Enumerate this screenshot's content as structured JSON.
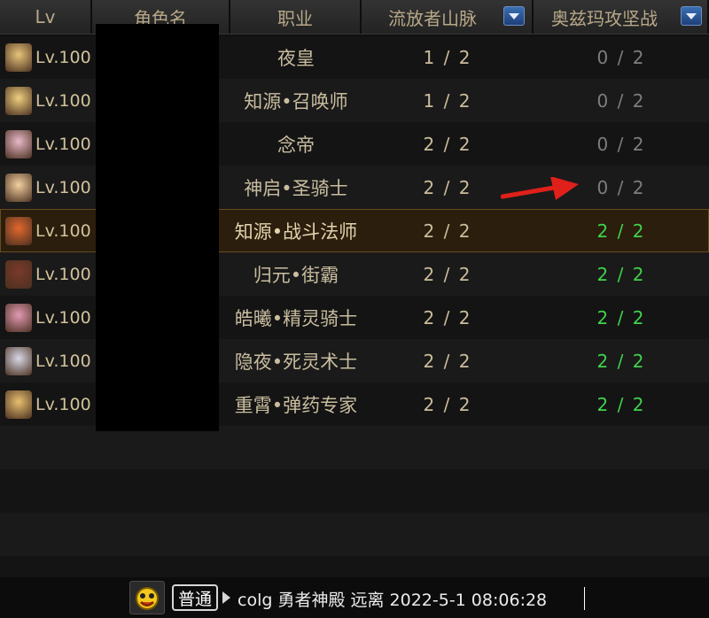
{
  "header": {
    "columns": [
      "Lv",
      "角色名",
      "职业",
      "流放者山脉",
      "奥兹玛攻坚战"
    ]
  },
  "rows": [
    {
      "level": "Lv.100",
      "job": "夜皇",
      "mountain": "1 / 2",
      "ozma": "0 / 2",
      "ozma_done": false,
      "avatar_color": "#e8c47a"
    },
    {
      "level": "Lv.100",
      "job": "知源•召唤师",
      "mountain": "1 / 2",
      "ozma": "0 / 2",
      "ozma_done": false,
      "avatar_color": "#f0d080"
    },
    {
      "level": "Lv.100",
      "job": "念帝",
      "mountain": "2 / 2",
      "ozma": "0 / 2",
      "ozma_done": false,
      "avatar_color": "#e9b8c8"
    },
    {
      "level": "Lv.100",
      "job": "神启•圣骑士",
      "mountain": "2 / 2",
      "ozma": "0 / 2",
      "ozma_done": false,
      "avatar_color": "#f2d0a0"
    },
    {
      "level": "Lv.100",
      "job": "知源•战斗法师",
      "mountain": "2 / 2",
      "ozma": "2 / 2",
      "ozma_done": true,
      "avatar_color": "#e2672e",
      "selected": true
    },
    {
      "level": "Lv.100",
      "job": "归元•街霸",
      "mountain": "2 / 2",
      "ozma": "2 / 2",
      "ozma_done": true,
      "avatar_color": "#7a3a2a"
    },
    {
      "level": "Lv.100",
      "job": "皓曦•精灵骑士",
      "mountain": "2 / 2",
      "ozma": "2 / 2",
      "ozma_done": true,
      "avatar_color": "#e39ab4"
    },
    {
      "level": "Lv.100",
      "job": "隐夜•死灵术士",
      "mountain": "2 / 2",
      "ozma": "2 / 2",
      "ozma_done": true,
      "avatar_color": "#d8d8e6"
    },
    {
      "level": "Lv.100",
      "job": "重霄•弹药专家",
      "mountain": "2 / 2",
      "ozma": "2 / 2",
      "ozma_done": true,
      "avatar_color": "#e8c070"
    }
  ],
  "empty_rows": 4,
  "chat": {
    "channel_label": "普通",
    "input_value": "colg 勇者神殿 远离 2022-5-1 08:06:28",
    "emoji_icon": "emoji-face-icon"
  },
  "annotation": {
    "arrow_color": "#e0201a"
  },
  "colors": {
    "ozma_done": "#3fd24a",
    "ozma_pending": "#7d7d7d",
    "selected_row": "#2b1e0d"
  }
}
